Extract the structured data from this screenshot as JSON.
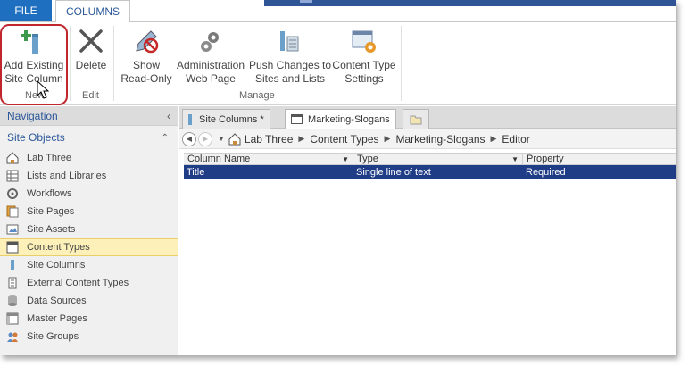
{
  "ribbon": {
    "tabs": {
      "file": "FILE",
      "columns": "COLUMNS"
    },
    "buttons": {
      "add_existing_site_column": "Add Existing Site Column",
      "delete": "Delete",
      "show_read_only": "Show Read-Only",
      "administration_web_page": "Administration Web Page",
      "push_changes": "Push Changes to Sites and Lists",
      "content_type_settings": "Content Type Settings"
    },
    "groups": {
      "new": "New",
      "edit": "Edit",
      "manage": "Manage"
    }
  },
  "navigation": {
    "header": "Navigation",
    "section": "Site Objects",
    "items": [
      {
        "label": "Lab Three",
        "icon": "home-icon"
      },
      {
        "label": "Lists and Libraries",
        "icon": "list-icon"
      },
      {
        "label": "Workflows",
        "icon": "workflow-icon"
      },
      {
        "label": "Site Pages",
        "icon": "pages-icon"
      },
      {
        "label": "Site Assets",
        "icon": "assets-icon"
      },
      {
        "label": "Content Types",
        "icon": "content-types-icon",
        "selected": true
      },
      {
        "label": "Site Columns",
        "icon": "site-columns-icon"
      },
      {
        "label": "External Content Types",
        "icon": "external-icon"
      },
      {
        "label": "Data Sources",
        "icon": "database-icon"
      },
      {
        "label": "Master Pages",
        "icon": "master-pages-icon"
      },
      {
        "label": "Site Groups",
        "icon": "groups-icon"
      }
    ]
  },
  "document_tabs": [
    {
      "label": "Site Columns *"
    },
    {
      "label": "Marketing-Slogans",
      "active": true
    }
  ],
  "breadcrumb": [
    "Lab Three",
    "Content Types",
    "Marketing-Slogans",
    "Editor"
  ],
  "grid": {
    "columns": [
      "Column Name",
      "Type",
      "Property"
    ],
    "rows": [
      {
        "name": "Title",
        "type": "Single line of text",
        "property": "Required"
      }
    ]
  },
  "colors": {
    "accent": "#1f6fc1",
    "selection": "#1f3c86",
    "nav_selected": "#fdf0b8",
    "highlight_ring": "#c0272d"
  }
}
